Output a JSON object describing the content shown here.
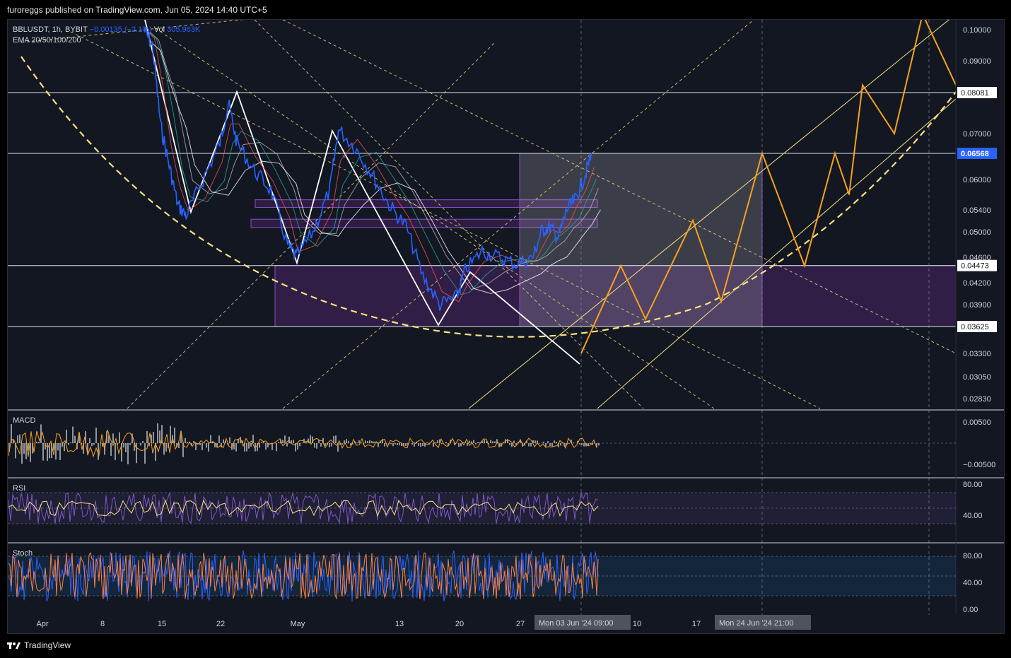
{
  "header": {
    "publisher": "furoreggs published on TradingView.com, Jun 05, 2024 14:40 UTC+5"
  },
  "legend": {
    "symbol": "BBLUSDT, 1h, BYBIT",
    "change": "−0.00135 (−2.1%)",
    "volume_label": "Vol",
    "volume": "305.963K",
    "ema": "EMA 20/50/100/200"
  },
  "panes": {
    "macd": "MACD",
    "rsi": "RSI",
    "stoch": "Stoch"
  },
  "footer": {
    "brand": "TradingView"
  },
  "colors": {
    "background": "#131722",
    "price": "#2962ff",
    "projection": "#f7a21b",
    "zone": "#6a2a8c",
    "yellow_dashed": "#f6e27f",
    "axis_text": "#d1d4dc"
  },
  "chart_data": {
    "type": "line",
    "title": "BBLUSDT, 1h, BYBIT",
    "price_axis": {
      "ticks": [
        "0.10000",
        "0.09000",
        "0.07000",
        "0.06000",
        "0.05400",
        "0.05000",
        "0.04600",
        "0.04200",
        "0.03900",
        "0.03300",
        "0.03050",
        "0.02830"
      ],
      "labeled_levels": [
        "0.08081",
        "0.06568",
        "0.04473",
        "0.03625"
      ],
      "current_price": "0.06568",
      "horizontal_levels": [
        0.08081,
        0.06568,
        0.04473,
        0.03625
      ]
    },
    "time_axis": {
      "ticks": [
        "Apr",
        "8",
        "15",
        "22",
        "May",
        "13",
        "20",
        "27",
        "3",
        "10",
        "17",
        "24"
      ],
      "crosshair_labels": [
        "Mon 03 Jun '24   09:00",
        "Mon 24 Jun '24   21:00"
      ]
    },
    "series": [
      {
        "name": "BBLUSDT",
        "points": [
          [
            "Apr 13",
            0.1
          ],
          [
            "Apr 14",
            0.095
          ],
          [
            "Apr 15",
            0.072
          ],
          [
            "Apr 16",
            0.063
          ],
          [
            "Apr 17",
            0.055
          ],
          [
            "Apr 18",
            0.053
          ],
          [
            "Apr 20",
            0.06
          ],
          [
            "Apr 22",
            0.068
          ],
          [
            "Apr 23",
            0.078
          ],
          [
            "Apr 24",
            0.068
          ],
          [
            "Apr 26",
            0.062
          ],
          [
            "Apr 28",
            0.058
          ],
          [
            "Apr 30",
            0.048
          ],
          [
            "May 1",
            0.046
          ],
          [
            "May 3",
            0.05
          ],
          [
            "May 5",
            0.058
          ],
          [
            "May 6",
            0.071
          ],
          [
            "May 8",
            0.067
          ],
          [
            "May 10",
            0.061
          ],
          [
            "May 12",
            0.055
          ],
          [
            "May 14",
            0.051
          ],
          [
            "May 16",
            0.043
          ],
          [
            "May 18",
            0.039
          ],
          [
            "May 20",
            0.04
          ],
          [
            "May 21",
            0.044
          ],
          [
            "May 23",
            0.047
          ],
          [
            "May 25",
            0.046
          ],
          [
            "May 27",
            0.045
          ],
          [
            "May 29",
            0.046
          ],
          [
            "May 30",
            0.05
          ],
          [
            "May 31",
            0.051
          ],
          [
            "Jun 1",
            0.049
          ],
          [
            "Jun 2",
            0.054
          ],
          [
            "Jun 3",
            0.056
          ],
          [
            "Jun 4",
            0.06
          ],
          [
            "Jun 5",
            0.0657
          ]
        ]
      }
    ],
    "projection": {
      "name": "projected path",
      "points": [
        0.033,
        0.0447,
        0.0372,
        0.0521,
        0.0394,
        0.0657,
        0.0447,
        0.0657,
        0.057,
        0.083,
        0.07,
        0.105,
        0.083
      ]
    },
    "zones": [
      {
        "low": 0.03625,
        "high": 0.04473
      },
      {
        "low": 0.0545,
        "high": 0.056
      },
      {
        "low": 0.0508,
        "high": 0.0523
      }
    ],
    "indicators": {
      "macd_ticks": [
        "0.00500",
        "−0.00500"
      ],
      "rsi_ticks": [
        "80.00",
        "40.00"
      ],
      "stoch_ticks": [
        "80.00",
        "40.00",
        "0.00"
      ]
    },
    "grid": false
  }
}
